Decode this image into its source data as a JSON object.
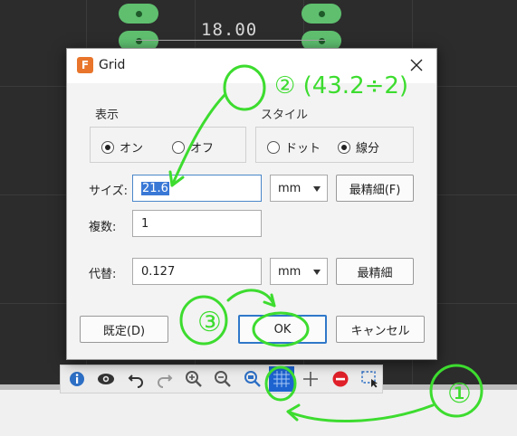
{
  "canvas": {
    "dimension_label": "18.00"
  },
  "dialog": {
    "app_icon": "F",
    "title": "Grid",
    "display": {
      "label": "表示",
      "on": "オン",
      "off": "オフ",
      "selected": "on"
    },
    "style": {
      "label": "スタイル",
      "dot": "ドット",
      "line": "線分",
      "selected": "line"
    },
    "size": {
      "label": "サイズ:",
      "value": "21.6",
      "unit": "mm",
      "finest_button": "最精細(F)"
    },
    "multiple": {
      "label": "複数:",
      "value": "1"
    },
    "alternate": {
      "label": "代替:",
      "value": "0.127",
      "unit": "mm",
      "finest_button": "最精細"
    },
    "buttons": {
      "default": "既定(D)",
      "ok": "OK",
      "cancel": "キャンセル"
    }
  },
  "annotations": {
    "note_2": "② (43.2÷2)",
    "note_3": "③",
    "note_1": "①"
  },
  "colors": {
    "annotation": "#3ddc2f",
    "accent": "#1e64d0",
    "pad": "#5fbf6f"
  }
}
